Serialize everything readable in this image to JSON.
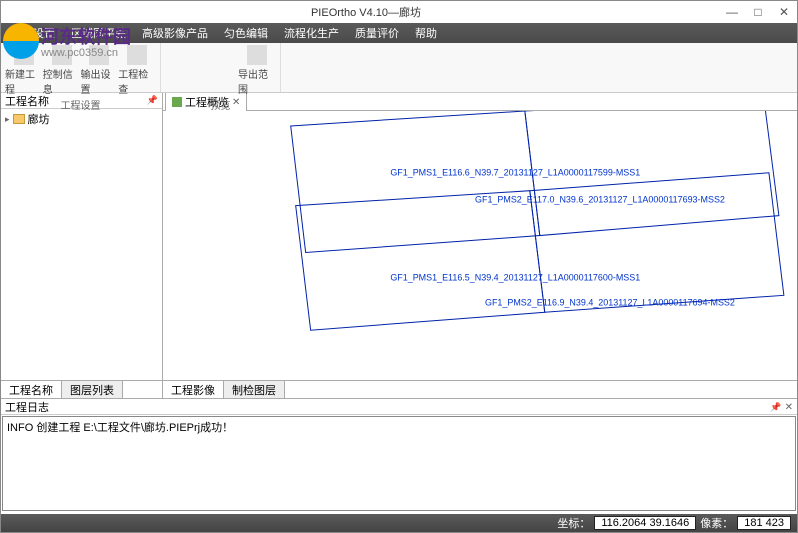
{
  "window": {
    "title": "PIEOrtho V4.10—廊坊",
    "min": "—",
    "max": "□",
    "close": "✕"
  },
  "menu": {
    "items": [
      "常用设置",
      "区域同平差",
      "高级影像产品",
      "匀色编辑",
      "流程化生产",
      "质量评价",
      "帮助"
    ]
  },
  "toolbar": {
    "groups": [
      {
        "label": "工程设置",
        "buttons": [
          "新建工程",
          "控制信息",
          "输出设置",
          "工程检查"
        ]
      },
      {
        "label": "预览",
        "buttons": [
          "导出范围"
        ]
      }
    ]
  },
  "leftPanel": {
    "header": "工程名称",
    "treeRoot": "廊坊",
    "tabs": [
      "工程名称",
      "图层列表"
    ]
  },
  "viewTabs": {
    "main": "工程概览"
  },
  "imageLabels": [
    "GF1_PMS1_E116.6_N39.7_20131127_L1A0000117599-MSS1",
    "GF1_PMS2_E117.0_N39.6_20131127_L1A0000117693-MSS2",
    "GF1_PMS1_E116.5_N39.4_20131127_L1A0000117600-MSS1",
    "GF1_PMS2_E116.9_N39.4_20131127_L1A0000117694-MSS2"
  ],
  "rightTabs": [
    "工程影像",
    "制检图层"
  ],
  "log": {
    "header": "工程日志",
    "line": "INFO 创建工程 E:\\工程文件\\廊坊.PIEPrj成功！"
  },
  "status": {
    "coordLabel": "坐标：",
    "coords": "116.2064  39.1646",
    "pixelLabel": "像素：",
    "pixels": "181  423"
  },
  "watermark": {
    "name": "河东软件园",
    "url": "www.pc0359.cn"
  }
}
